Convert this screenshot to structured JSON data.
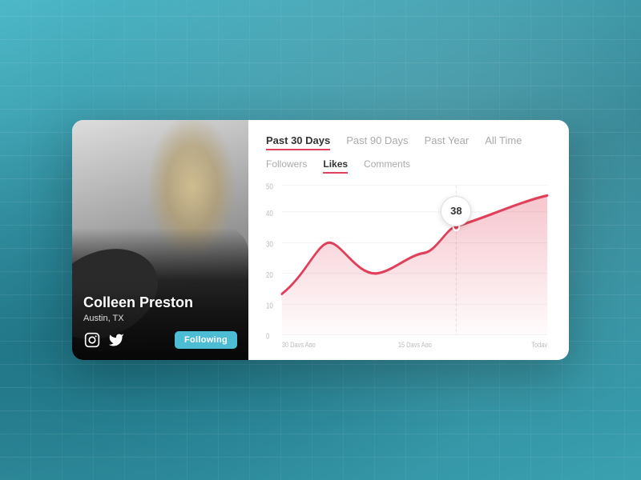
{
  "background": {
    "color": "#3a9aaa"
  },
  "card": {
    "profile": {
      "name": "Colleen Preston",
      "location": "Austin, TX",
      "following_label": "Following",
      "instagram_icon": "📷",
      "twitter_icon": "🐦"
    },
    "time_tabs": [
      {
        "id": "past30",
        "label": "Past 30 Days",
        "active": true
      },
      {
        "id": "past90",
        "label": "Past 90 Days",
        "active": false
      },
      {
        "id": "pastYear",
        "label": "Past Year",
        "active": false
      },
      {
        "id": "allTime",
        "label": "All Time",
        "active": false
      }
    ],
    "metric_tabs": [
      {
        "id": "followers",
        "label": "Followers",
        "active": false
      },
      {
        "id": "likes",
        "label": "Likes",
        "active": true
      },
      {
        "id": "comments",
        "label": "Comments",
        "active": false
      }
    ],
    "chart": {
      "tooltip_value": "38",
      "x_labels": [
        "30 Days Ago",
        "15 Days Ago",
        "Today"
      ],
      "y_labels": [
        "0",
        "10",
        "20",
        "30",
        "40",
        "50"
      ],
      "line_color": "#e0405a",
      "fill_color": "rgba(224,64,90,0.15)"
    }
  }
}
